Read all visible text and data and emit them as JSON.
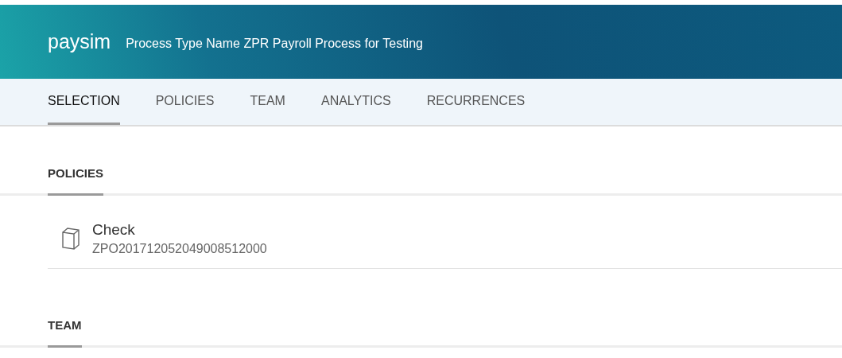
{
  "header": {
    "app_name": "paysim",
    "subtitle": "Process Type Name ZPR Payroll Process for Testing"
  },
  "tabs": [
    {
      "label": "SELECTION",
      "selected": true
    },
    {
      "label": "POLICIES",
      "selected": false
    },
    {
      "label": "TEAM",
      "selected": false
    },
    {
      "label": "ANALYTICS",
      "selected": false
    },
    {
      "label": "RECURRENCES",
      "selected": false
    }
  ],
  "sections": [
    {
      "title": "POLICIES",
      "items": [
        {
          "title": "Check",
          "subtitle": "ZPO201712052049008512000"
        }
      ]
    },
    {
      "title": "TEAM"
    }
  ]
}
